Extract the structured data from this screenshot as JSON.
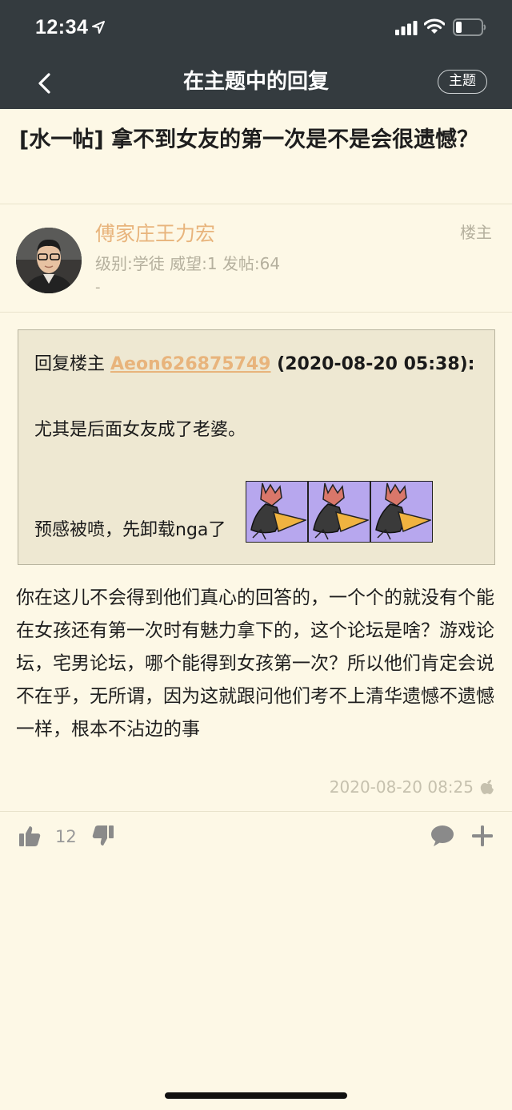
{
  "status_bar": {
    "time": "12:34"
  },
  "nav": {
    "title": "在主题中的回复",
    "topic_button": "主题"
  },
  "thread": {
    "title": "[水一帖] 拿不到女友的第一次是不是会很遗憾？"
  },
  "post": {
    "author": {
      "name": "傅家庄王力宏",
      "meta": "级别:学徒  威望:1  发帖:64",
      "extra": "-"
    },
    "floor_label": "楼主",
    "quote": {
      "prefix": "回复楼主 ",
      "user": "Aeon626875749",
      "date": " (2020-08-20 05:38):",
      "line1": "尤其是后面女友成了老婆。",
      "line2": "预感被喷，先卸载nga了",
      "sticker_count": 3
    },
    "body": "你在这儿不会得到他们真心的回答的，一个个的就没有个能在女孩还有第一次时有魅力拿下的，这个论坛是啥？游戏论坛，宅男论坛，哪个能得到女孩第一次？所以他们肯定会说不在乎，无所谓，因为这就跟问他们考不上清华遗憾不遗憾一样，根本不沾边的事",
    "timestamp": "2020-08-20 08:25",
    "likes": "12"
  },
  "colors": {
    "header_bg": "#343b3f",
    "page_bg": "#fdf8e6",
    "accent": "#e8b47c",
    "quote_bg": "#eee8d2"
  }
}
